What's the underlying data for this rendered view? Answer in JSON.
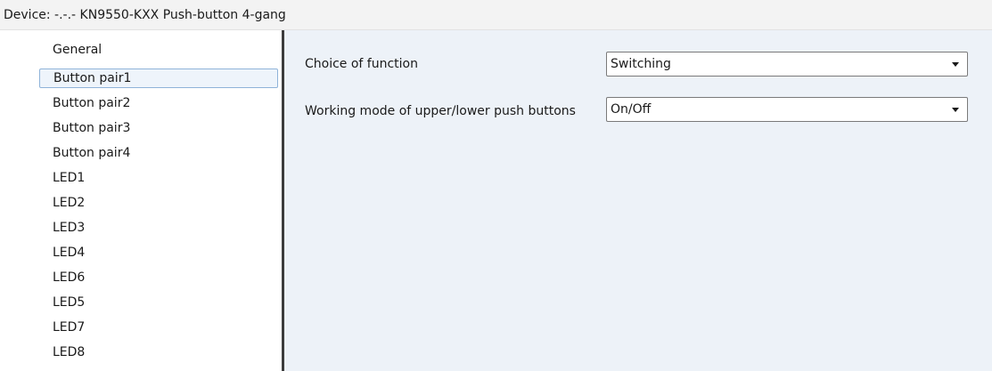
{
  "window": {
    "title": "Device: -.-.-  KN9550-KXX Push-button 4-gang"
  },
  "sidebar": {
    "items": [
      {
        "label": "General"
      },
      {
        "label": "Button pair1"
      },
      {
        "label": "Button pair2"
      },
      {
        "label": "Button pair3"
      },
      {
        "label": "Button pair4"
      },
      {
        "label": "LED1"
      },
      {
        "label": "LED2"
      },
      {
        "label": "LED3"
      },
      {
        "label": "LED4"
      },
      {
        "label": "LED6"
      },
      {
        "label": "LED5"
      },
      {
        "label": "LED7"
      },
      {
        "label": "LED8"
      }
    ],
    "selected_label": "Button pair1"
  },
  "parameters": [
    {
      "label": "Choice of function",
      "value": "Switching"
    },
    {
      "label": "Working mode of upper/lower push buttons",
      "value": "On/Off"
    }
  ],
  "colors": {
    "content_background": "#edf2f8",
    "selection_border": "#8fb3d9",
    "selection_background": "#eef4fb"
  }
}
